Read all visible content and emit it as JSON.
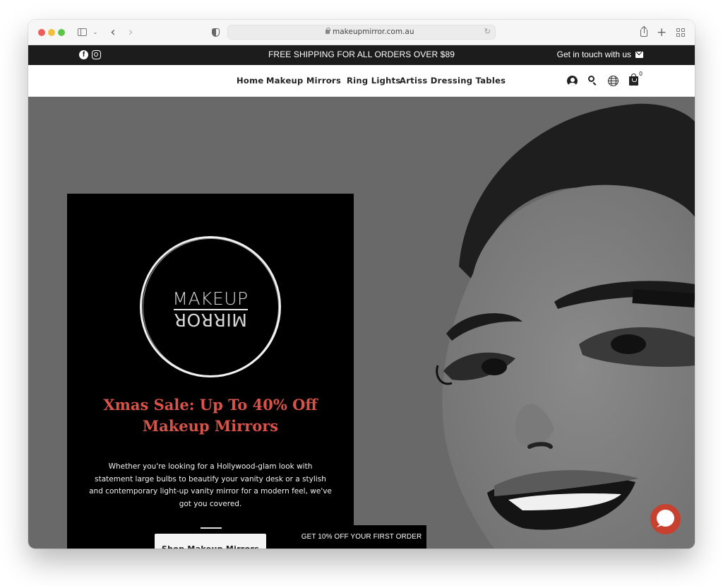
{
  "browser": {
    "url": "makeupmirror.com.au",
    "icons": [
      "sidebar-icon",
      "chevron-down-icon",
      "back-icon",
      "forward-icon",
      "privacy-shield-icon",
      "lock-icon",
      "reload-icon",
      "share-icon",
      "new-tab-icon",
      "tab-overview-icon"
    ],
    "back_glyph": "‹",
    "forward_glyph": "›",
    "chevron_glyph": "⌄",
    "reload_glyph": "↻",
    "newtab_glyph": "+"
  },
  "announcement": {
    "text": "FREE SHIPPING FOR ALL ORDERS OVER $89",
    "contact_label": "Get in touch with us",
    "social": [
      "facebook",
      "instagram"
    ],
    "facebook_glyph": "f"
  },
  "nav": {
    "items": [
      {
        "label": "Home"
      },
      {
        "label": "Makeup Mirrors",
        "has_dropdown": true
      },
      {
        "label": "Ring Lights"
      },
      {
        "label": "Artiss Dressing Tables"
      }
    ],
    "dropdown_glyph": "⌄",
    "cart_count": "0"
  },
  "hero": {
    "logo": {
      "top_word": "MAKEUP",
      "bottom_word": "MIRROR"
    },
    "headline_line1": "Xmas Sale: Up To 40% Off",
    "headline_line2": "Makeup Mirrors",
    "body": "Whether you're looking for a Hollywood-glam look with statement large bulbs to beautify your vanity desk or a stylish and contemporary light-up vanity mirror for a modern feel, we've got you covered.",
    "cta_label": "Shop Makeup Mirrors"
  },
  "discount_tab": {
    "label": "GET 10% OFF YOUR FIRST ORDER"
  },
  "colors": {
    "announcement_bg": "#1c1c1c",
    "hero_bg": "#696969",
    "headline_red": "#d9534a",
    "chat_red": "#c8412f"
  }
}
